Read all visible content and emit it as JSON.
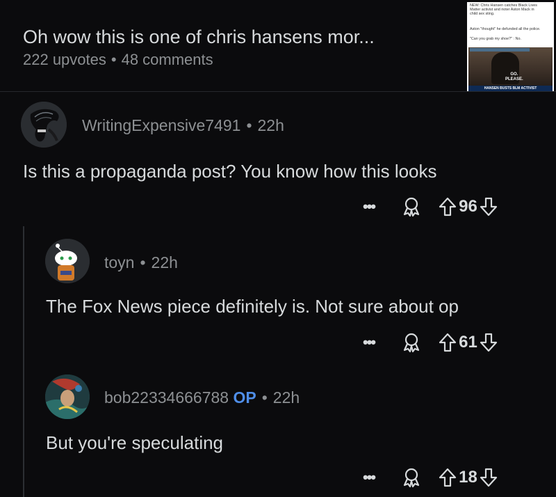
{
  "post": {
    "title": "Oh wow this is one of chris hansens mor...",
    "upvotes": "222 upvotes",
    "separator": "•",
    "comments": "48 comments"
  },
  "thumbnail": {
    "line1": "NEW: Chris Hansen catches Black Lives",
    "line2": "Matter activist and rioter Aston Mack in",
    "line3": "child sex sting.",
    "line4": "Aston \"thought\" he defunded all the police.",
    "line5": "\"Can you grab my shoe?\" : No.",
    "caption_go": "GO.",
    "caption_please": "PLEASE.",
    "band": "HANSEN BUSTS BLM ACTIVIST"
  },
  "comments": [
    {
      "username": "WritingExpensive7491",
      "separator": "•",
      "time": "22h",
      "text": "Is this a propaganda post? You know how this looks",
      "votes": "96",
      "more": "•••"
    },
    {
      "username": "toyn",
      "separator": "•",
      "time": "22h",
      "text": "The Fox News piece definitely is. Not sure about op",
      "votes": "61",
      "more": "•••"
    },
    {
      "username": "bob22334666788",
      "op_label": "OP",
      "separator": "•",
      "time": "22h",
      "text": "But you're speculating",
      "votes": "18",
      "more": "•••"
    }
  ],
  "icons": {
    "award": "award-icon",
    "upvote": "upvote-arrow-icon",
    "downvote": "downvote-arrow-icon",
    "more": "more-options-icon"
  }
}
